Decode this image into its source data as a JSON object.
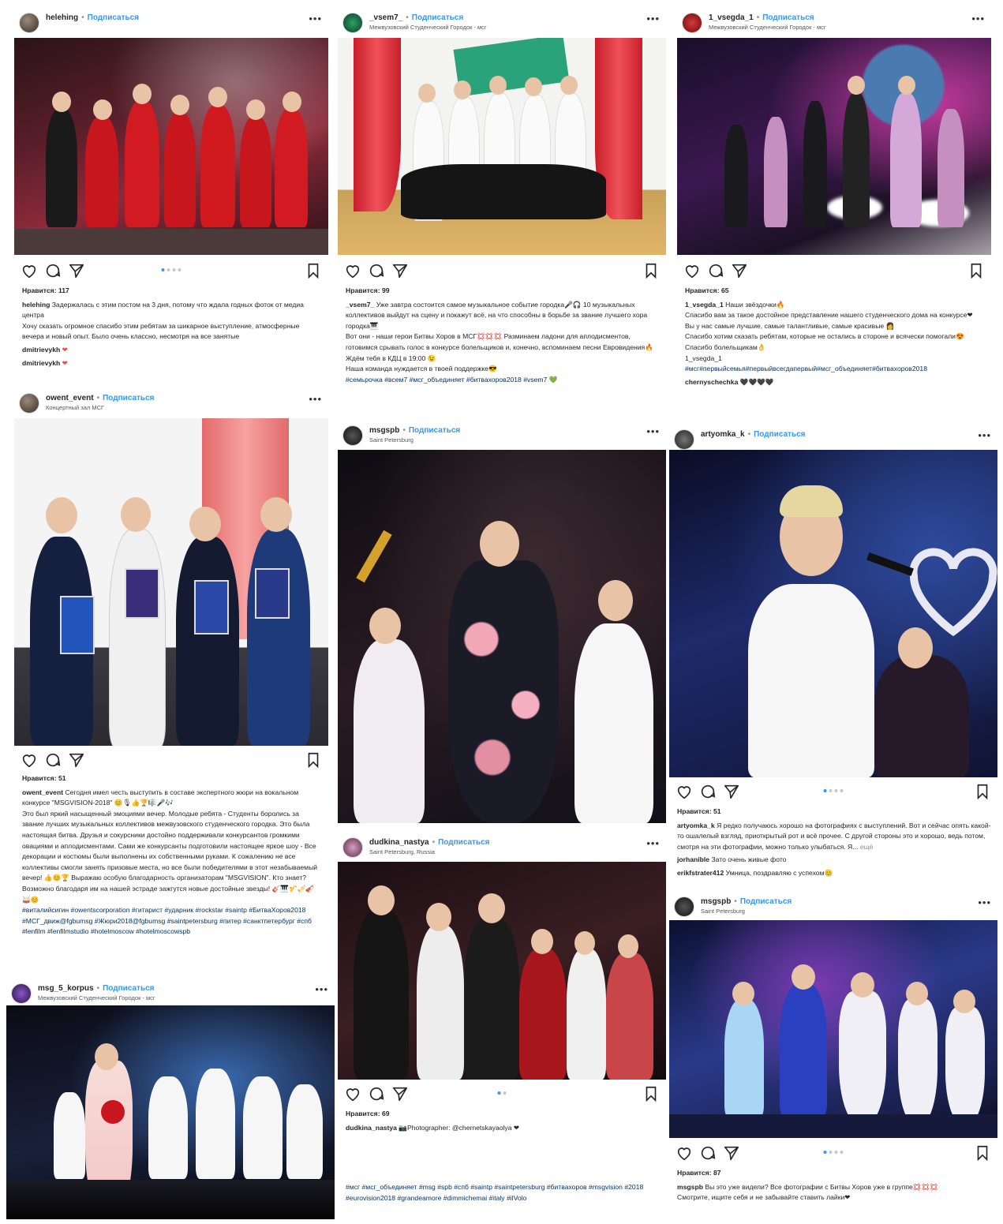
{
  "ui": {
    "follow": "Подписаться",
    "more": "•••",
    "likes_label": "Нравится:"
  },
  "posts": {
    "p1": {
      "username": "helehing",
      "location": "",
      "likes": "117",
      "caption_user": "helehing",
      "caption": "Задержалась с этим постом на 3 дня, потому что ждала годных фоток от медиа центра",
      "caption2": "Хочу сказать огромное спасибо этим ребятам за шикарное выступление, атмосферные вечера и новый опыт. Было очень классно, несмотря на все занятые",
      "comments": [
        {
          "user": "dmitrievykh",
          "text": "❤"
        },
        {
          "user": "dmitrievykh",
          "text": "❤"
        }
      ]
    },
    "p2": {
      "username": "_vsem7_",
      "location": "Межвузовский Студенческий Городок - мсг",
      "likes": "99",
      "caption_user": "_vsem7_",
      "caption": "Уже завтра состоится самое музыкальное событие городка🎤🎧 10 музыкальных коллективов выйдут на сцену и покажут всё, на что способны в борьбе за звание лучшего хора городка🎹",
      "caption2": "Вот они - наши герои Битвы Хоров в МСГ💢💢💢 Разминаем ладони для аплодисментов, готовимся срывать голос в конкурсе болельщиков и, конечно, вспоминаем песни Евровидения🔥",
      "caption3": "Ждём тебя в КДЦ в 19:00 😉",
      "caption4": "Наша команда нуждается в твоей поддержке😎",
      "tags": "#семьрочка #всем7 #мсг_объединяет #битвахоров2018 #vsem7 💚"
    },
    "p3": {
      "username": "1_vsegda_1",
      "location": "Межвузовский Студенческий Городок - мсг",
      "likes": "65",
      "caption_user": "1_vsegda_1",
      "caption": "Наши звёздочки🔥",
      "caption2": "Спасибо вам за такое достойное представление нашего студенческого дома на конкурсе❤",
      "caption3": "Вы у нас самые лучшие, самые талантливые, самые красивые 👩",
      "caption4": "Спасибо хотим сказать ребятам, которые не остались в стороне и всячески помогали😍Спасибо болельщикам👌",
      "caption5_user": "1_vsegda_1",
      "tags": "#мсг#первыйсемья#первыйвсегдапервый#мсг_объединяет#битвахоров2018",
      "comment_user": "chernyschechka",
      "comment_text": "🖤🖤🖤🖤"
    },
    "p4": {
      "username": "owent_event",
      "location": "Концертный зал МСГ",
      "likes": "51",
      "caption_user": "owent_event",
      "caption": "Сегодня имел честь выступить в составе экспертного жюри на вокальном конкурсе \"MSGVISION-2018\" 😊🎙👍🏆🎼🎤🎶",
      "caption2": "Это был яркий насыщенный эмоциями вечер. Молодые ребята - Студенты боролись за звание лучших музыкальных коллективов межвузовского студенческого городка. Это была настоящая битва. Друзья и сокурсники достойно поддерживали конкурсантов громкими овациями и аплодисментами. Сами же конкурсанты подготовили настоящее яркое шоу - Все декорации и костюмы были выполнены их собственными руками. К сожалению не все коллективы смогли занять призовые места, но все были победителями в этот незабываемый вечер! 👍😊🏆 Выражаю особую благодарность организаторам \"MSGVISION\". Кто знает? Возможно благодаря им на нашей эстраде зажгутся новые достойные звезды! 🎸🎹🎷🎺🎻🥁😊",
      "tags": "#виталийсигин #owentscorporation #гитарист #ударник #rockstar #saintp #БитваХоров2018 #МСГ_движ@fgbumsg #Жюри2018@fgbumsg #saintpetersburg #питер #санктпетербург #спб #lenfilm #lenfilmstudio #hotelmoscow #hotelmoscowspb"
    },
    "p5": {
      "username": "msgspb",
      "location": "Saint Petersburg"
    },
    "p6": {
      "username": "artyomka_k",
      "location": "",
      "likes": "51",
      "caption_user": "artyomka_k",
      "caption": "Я редко получаюсь хорошо на фотографиях с выступлений. Вот и сейчас опять какой-то ошалелый взгляд, приоткрытый рот и всё прочее. С другой стороны это и хорошо, ведь потом, смотря на эти фотографии, можно только улыбаться. Я...",
      "more_label": "ещё",
      "comments": [
        {
          "user": "jorhanible",
          "text": "Зато очень живые фото"
        },
        {
          "user": "erikfstrater412",
          "text": "Умница, поздравляю с успехом😊"
        }
      ]
    },
    "p7": {
      "username": "msg_5_korpus",
      "location": "Межвузовский Студенческий Городок - мсг"
    },
    "p8": {
      "username": "dudkina_nastya",
      "location": "Saint Petersburg, Russia",
      "likes": "69",
      "caption_user": "dudkina_nastya",
      "caption": "📷Photographer: @chernetskayaolya ❤",
      "tags": "#мсг #мсг_объединяет #msg #spb #спб #saintp #saintpetersburg #битвахоров #msgvision #2018 #eurovision2018 #grandeamore #dimmichemai #italy #ilVolo"
    },
    "p9": {
      "username": "msgspb",
      "location": "Saint Petersburg",
      "likes": "87",
      "caption_user": "msgspb",
      "caption": "Вы это уже видели? Все фотографии с Битвы Хоров уже в группе💢💢💢",
      "caption2": "Смотрите, ищите себя и не забывайте ставить лайки❤"
    }
  },
  "colors": {
    "link": "#3897f0",
    "tag": "#003569",
    "heart": "#ed4956",
    "dot_active": "#3897f0",
    "dot": "#c7c7c7"
  }
}
